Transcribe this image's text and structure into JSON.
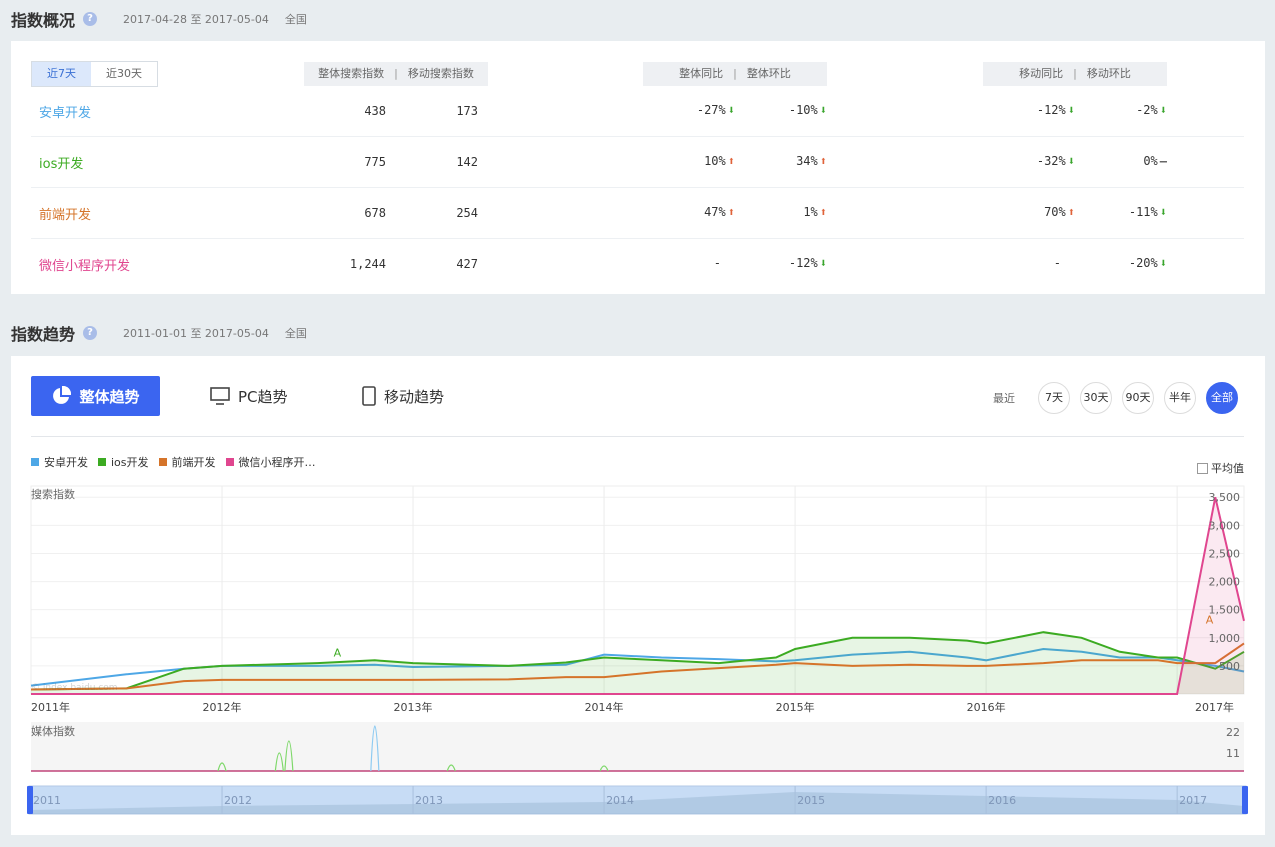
{
  "section1": {
    "title": "指数概况",
    "help": "?",
    "range": "2017-04-28 至 2017-05-04",
    "region": "全国",
    "periods": [
      "近7天",
      "近30天"
    ],
    "headers": {
      "overall_search": "整体搜索指数",
      "mobile_search": "移动搜索指数",
      "overall_yoy": "整体同比",
      "overall_mom": "整体环比",
      "mobile_yoy": "移动同比",
      "mobile_mom": "移动环比",
      "sep": "|"
    },
    "rows": [
      {
        "name": "安卓开发",
        "color": "#4ea7e6",
        "overall": "438",
        "mobile": "173",
        "overall_yoy": "-27%",
        "overall_yoy_dir": "down",
        "overall_mom": "-10%",
        "overall_mom_dir": "down",
        "mobile_yoy": "-12%",
        "mobile_yoy_dir": "down",
        "mobile_mom": "-2%",
        "mobile_mom_dir": "down"
      },
      {
        "name": "ios开发",
        "color": "#3cab22",
        "overall": "775",
        "mobile": "142",
        "overall_yoy": "10%",
        "overall_yoy_dir": "up",
        "overall_mom": "34%",
        "overall_mom_dir": "up",
        "mobile_yoy": "-32%",
        "mobile_yoy_dir": "down",
        "mobile_mom": "0%",
        "mobile_mom_dir": "flat"
      },
      {
        "name": "前端开发",
        "color": "#d5742a",
        "overall": "678",
        "mobile": "254",
        "overall_yoy": "47%",
        "overall_yoy_dir": "up",
        "overall_mom": "1%",
        "overall_mom_dir": "up",
        "mobile_yoy": "70%",
        "mobile_yoy_dir": "up",
        "mobile_mom": "-11%",
        "mobile_mom_dir": "down"
      },
      {
        "name": "微信小程序开发",
        "color": "#e0468f",
        "overall": "1,244",
        "mobile": "427",
        "overall_yoy": "-",
        "overall_yoy_dir": "none",
        "overall_mom": "-12%",
        "overall_mom_dir": "down",
        "mobile_yoy": "-",
        "mobile_yoy_dir": "none",
        "mobile_mom": "-20%",
        "mobile_mom_dir": "down"
      }
    ]
  },
  "section2": {
    "title": "指数趋势",
    "help": "?",
    "range": "2011-01-01 至 2017-05-04",
    "region": "全国",
    "tabs": [
      "整体趋势",
      "PC趋势",
      "移动趋势"
    ],
    "recent_label": "最近",
    "recent_buttons": [
      "7天",
      "30天",
      "90天",
      "半年",
      "全部"
    ],
    "active_recent": "全部",
    "avg_label": "平均值",
    "legend": [
      {
        "name": "安卓开发",
        "color": "#4ea7e6"
      },
      {
        "name": "ios开发",
        "color": "#3cab22"
      },
      {
        "name": "前端开发",
        "color": "#d5742a"
      },
      {
        "name": "微信小程序开…",
        "color": "#e0468f"
      }
    ],
    "search_label": "搜索指数",
    "media_label": "媒体指数",
    "watermark": "© index.baidu.com",
    "marker_a": "A"
  },
  "chart_data": {
    "type": "line",
    "title": "",
    "ylabel": "搜索指数",
    "x_ticks": [
      "2011年",
      "2012年",
      "2013年",
      "2014年",
      "2015年",
      "2016年",
      "2017年"
    ],
    "y_ticks": [
      500,
      1000,
      1500,
      2000,
      2500,
      3000,
      3500
    ],
    "ylim": [
      0,
      3700
    ],
    "x": [
      2011.0,
      2011.5,
      2011.8,
      2012.0,
      2012.5,
      2012.8,
      2013.0,
      2013.5,
      2013.8,
      2014.0,
      2014.3,
      2014.6,
      2014.9,
      2015.0,
      2015.3,
      2015.6,
      2015.9,
      2016.0,
      2016.3,
      2016.5,
      2016.7,
      2016.9,
      2017.0,
      2017.2,
      2017.35
    ],
    "series": [
      {
        "name": "安卓开发",
        "values": [
          150,
          350,
          450,
          500,
          500,
          520,
          480,
          500,
          520,
          700,
          650,
          620,
          580,
          600,
          700,
          750,
          650,
          600,
          800,
          750,
          650,
          650,
          600,
          500,
          400
        ]
      },
      {
        "name": "ios开发",
        "values": [
          80,
          100,
          450,
          500,
          550,
          600,
          550,
          500,
          560,
          650,
          600,
          550,
          650,
          800,
          1000,
          1000,
          950,
          900,
          1100,
          1000,
          750,
          650,
          650,
          450,
          750
        ]
      },
      {
        "name": "前端开发",
        "values": [
          80,
          100,
          230,
          250,
          250,
          250,
          250,
          260,
          300,
          300,
          400,
          460,
          520,
          550,
          500,
          520,
          500,
          500,
          550,
          600,
          600,
          600,
          550,
          550,
          900
        ]
      },
      {
        "name": "微信小程序开发",
        "values": [
          0,
          0,
          0,
          0,
          0,
          0,
          0,
          0,
          0,
          0,
          0,
          0,
          0,
          0,
          0,
          0,
          0,
          0,
          0,
          0,
          0,
          0,
          0,
          3500,
          1300
        ]
      }
    ],
    "media_chart": {
      "type": "line",
      "ylabel": "媒体指数",
      "y_ticks": [
        11,
        22
      ]
    },
    "navigator_ticks": [
      "2011",
      "2012",
      "2013",
      "2014",
      "2015",
      "2016",
      "2017"
    ]
  }
}
